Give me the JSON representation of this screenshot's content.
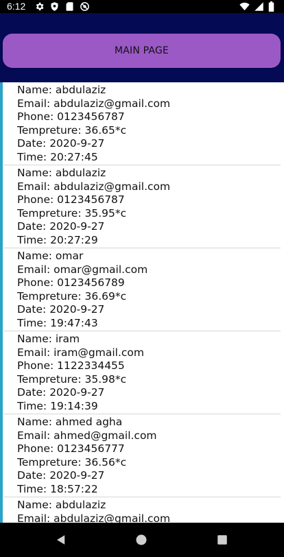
{
  "status_bar": {
    "time": "6:12",
    "icons_left": [
      "gear-icon",
      "shield-icon",
      "sd-card-icon",
      "no-tracking-icon"
    ],
    "icons_right": [
      "wifi-icon",
      "signal-icon",
      "battery-icon"
    ]
  },
  "header": {
    "main_button_label": "MAIN PAGE"
  },
  "records": [
    {
      "name": "Name: abdulaziz",
      "email": "Email: abdulaziz@gmail.com",
      "phone": "Phone: 0123456787",
      "temperature": "Tempreture: 36.65*c",
      "date": "Date: 2020-9-27",
      "time": "Time: 20:27:45"
    },
    {
      "name": "Name: abdulaziz",
      "email": "Email: abdulaziz@gmail.com",
      "phone": "Phone: 0123456787",
      "temperature": "Tempreture: 35.95*c",
      "date": "Date: 2020-9-27",
      "time": "Time: 20:27:29"
    },
    {
      "name": "Name: omar",
      "email": "Email: omar@gmail.com",
      "phone": "Phone: 0123456789",
      "temperature": "Tempreture: 36.69*c",
      "date": "Date: 2020-9-27",
      "time": "Time: 19:47:43"
    },
    {
      "name": "Name: iram",
      "email": "Email: iram@gmail.com",
      "phone": "Phone: 1122334455",
      "temperature": "Tempreture: 35.98*c",
      "date": "Date: 2020-9-27",
      "time": "Time: 19:14:39"
    },
    {
      "name": "Name: ahmed agha",
      "email": "Email: ahmed@gmail.com",
      "phone": "Phone: 0123456777",
      "temperature": "Tempreture: 36.56*c",
      "date": "Date: 2020-9-27",
      "time": "Time: 18:57:22"
    },
    {
      "name": "Name: abdulaziz",
      "email": "Email: abdulaziz@gmail.com"
    }
  ],
  "nav_bar": {
    "buttons": [
      "back-icon",
      "home-icon",
      "recents-icon"
    ]
  },
  "colors": {
    "header_bg": "#050a55",
    "button_bg": "#9b59c6",
    "list_bg": "#ffffff",
    "divider": "#d6d6d6",
    "accent_edge": "#2aa3c9"
  }
}
